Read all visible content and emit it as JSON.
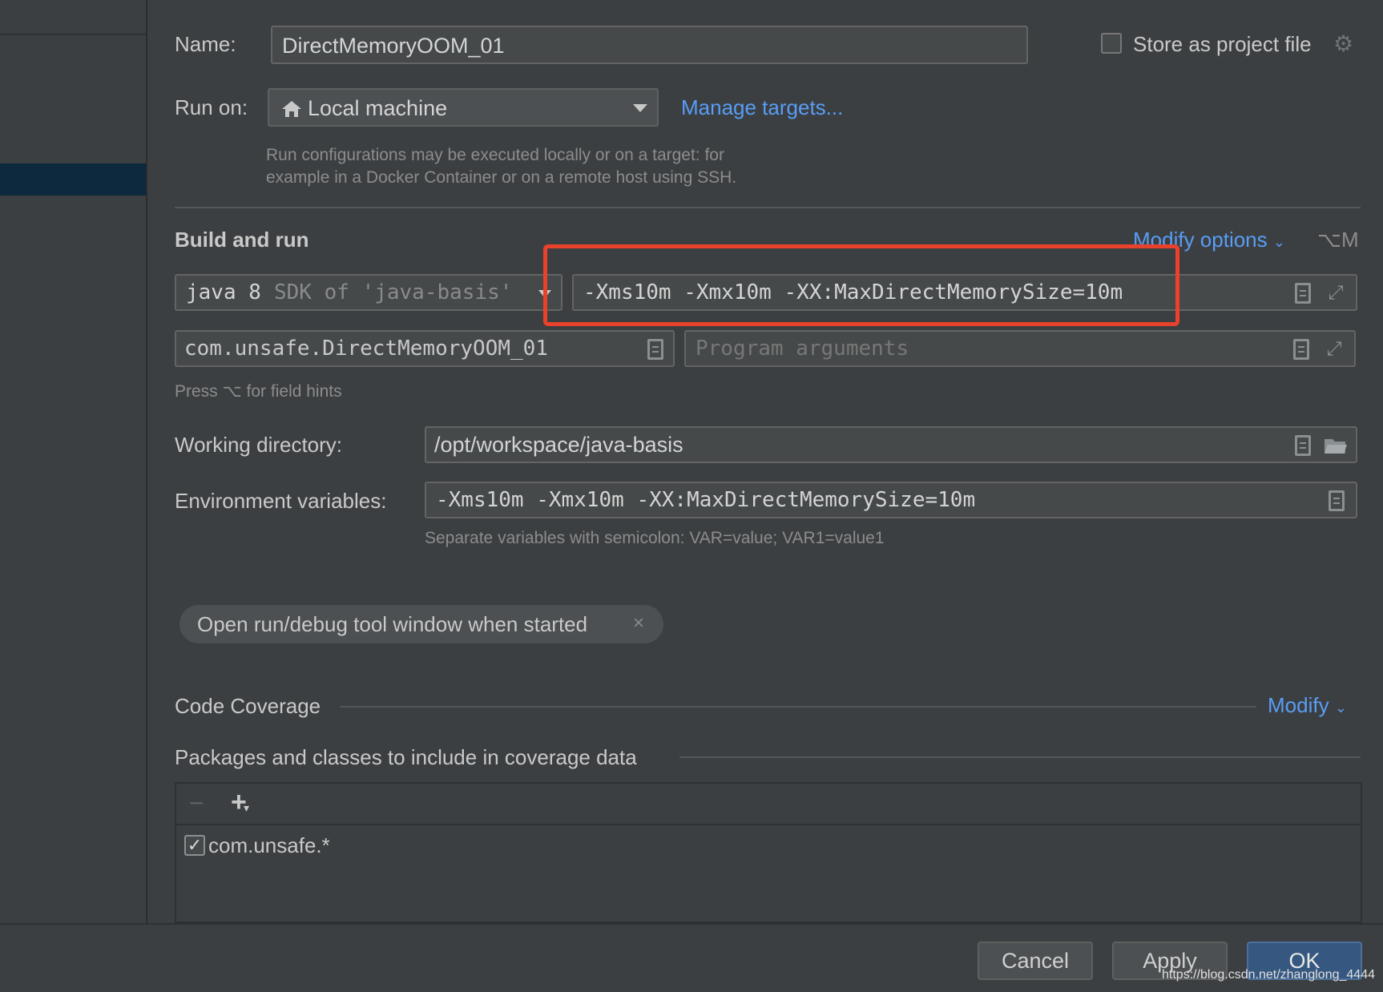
{
  "name": {
    "label": "Name:",
    "value": "DirectMemoryOOM_01"
  },
  "store": {
    "label": "Store as project file",
    "checked": false
  },
  "run_on": {
    "label": "Run on:",
    "value": "Local machine",
    "manage_link": "Manage targets...",
    "hint_line1": "Run configurations may be executed locally or on a target: for",
    "hint_line2": "example in a Docker Container or on a remote host using SSH."
  },
  "build_run": {
    "title": "Build and run",
    "modify_options": "Modify options",
    "shortcut": "⌥M",
    "sdk_main": "java 8",
    "sdk_detail": "SDK of 'java-basis'",
    "vm_options": "-Xms10m -Xmx10m -XX:MaxDirectMemorySize=10m",
    "main_class": "com.unsafe.DirectMemoryOOM_01",
    "program_args_placeholder": "Program arguments",
    "field_hint": "Press ⌥ for field hints"
  },
  "working_dir": {
    "label": "Working directory:",
    "value": "/opt/workspace/java-basis"
  },
  "env_vars": {
    "label": "Environment variables:",
    "value": "-Xms10m -Xmx10m -XX:MaxDirectMemorySize=10m",
    "hint": "Separate variables with semicolon: VAR=value; VAR1=value1"
  },
  "tag": {
    "label": "Open run/debug tool window when started"
  },
  "coverage": {
    "title": "Code Coverage",
    "modify": "Modify",
    "packages_title": "Packages and classes to include in coverage data",
    "items": [
      {
        "label": "com.unsafe.*",
        "checked": true
      }
    ]
  },
  "buttons": {
    "cancel": "Cancel",
    "apply": "Apply",
    "ok": "OK"
  },
  "watermark": "https://blog.csdn.net/zhanglong_4444",
  "colors": {
    "highlight": "#e8412c",
    "link": "#589df6",
    "ok_button": "#365880"
  }
}
